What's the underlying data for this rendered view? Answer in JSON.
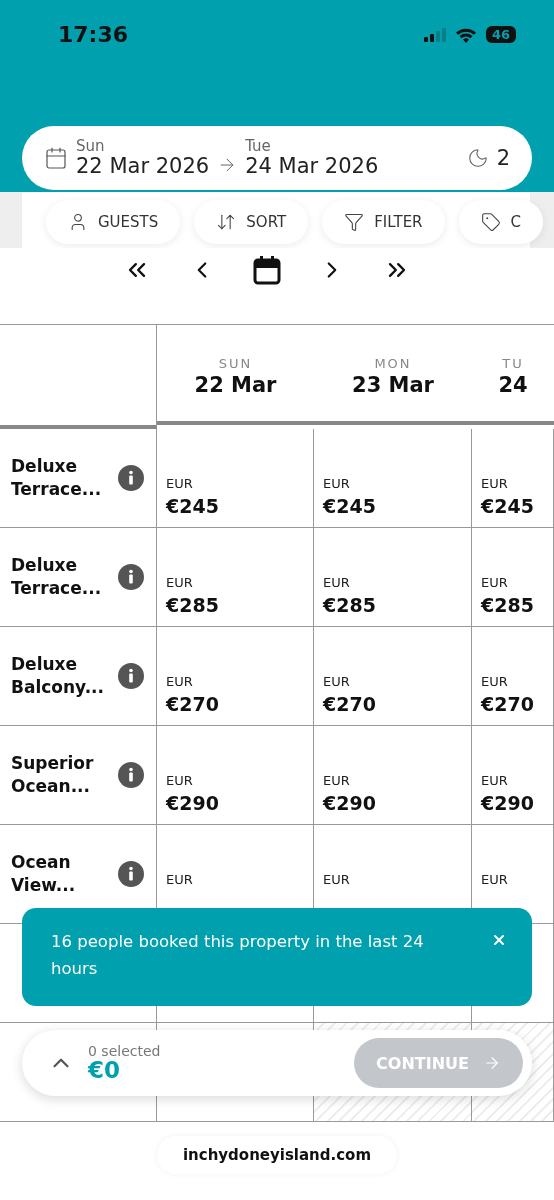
{
  "status_bar": {
    "time": "17:36",
    "battery": "46"
  },
  "dates": {
    "checkin_day": "Sun",
    "checkin_date": "22 Mar 2026",
    "checkout_day": "Tue",
    "checkout_date": "24 Mar 2026",
    "nights": "2"
  },
  "chips": [
    {
      "kind": "guests",
      "label": "GUESTS"
    },
    {
      "kind": "sort",
      "label": "SORT"
    },
    {
      "kind": "filter",
      "label": "FILTER"
    },
    {
      "kind": "tag",
      "label": "C"
    }
  ],
  "columns": [
    {
      "day": "SUN",
      "date": "22 Mar"
    },
    {
      "day": "MON",
      "date": "23 Mar"
    },
    {
      "day": "TU",
      "date": "24"
    }
  ],
  "rooms": [
    {
      "name": "Deluxe Terrace...",
      "cells": [
        {
          "available": true,
          "currency": "EUR",
          "price": "€245"
        },
        {
          "available": true,
          "currency": "EUR",
          "price": "€245"
        },
        {
          "available": true,
          "currency": "EUR",
          "price": "€245"
        }
      ]
    },
    {
      "name": "Deluxe Terrace...",
      "cells": [
        {
          "available": true,
          "currency": "EUR",
          "price": "€285"
        },
        {
          "available": true,
          "currency": "EUR",
          "price": "€285"
        },
        {
          "available": true,
          "currency": "EUR",
          "price": "€285"
        }
      ]
    },
    {
      "name": "Deluxe Balcony...",
      "cells": [
        {
          "available": true,
          "currency": "EUR",
          "price": "€270"
        },
        {
          "available": true,
          "currency": "EUR",
          "price": "€270"
        },
        {
          "available": true,
          "currency": "EUR",
          "price": "€270"
        }
      ]
    },
    {
      "name": "Superior Ocean...",
      "cells": [
        {
          "available": true,
          "currency": "EUR",
          "price": "€290"
        },
        {
          "available": true,
          "currency": "EUR",
          "price": "€290"
        },
        {
          "available": true,
          "currency": "EUR",
          "price": "€290"
        }
      ]
    },
    {
      "name": "Ocean View...",
      "cells": [
        {
          "available": true,
          "currency": "EUR"
        },
        {
          "available": true,
          "currency": "EUR"
        },
        {
          "available": true,
          "currency": "EUR"
        }
      ]
    },
    {
      "cells": [
        {
          "available": true
        },
        {
          "available": true
        },
        {
          "available": true
        }
      ]
    },
    {
      "cells": [
        {
          "available": true
        },
        {
          "available": false
        },
        {
          "available": false
        }
      ]
    }
  ],
  "toast": {
    "message": "16 people booked this property in the last 24 hours"
  },
  "selection_bar": {
    "count": "0 selected",
    "total": "€0",
    "button": "CONTINUE",
    "button_disabled": true
  },
  "footer": {
    "domain": "inchydoneyisland.com"
  }
}
